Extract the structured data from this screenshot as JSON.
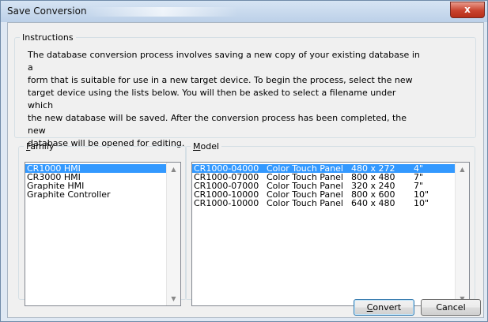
{
  "window": {
    "title": "Save Conversion",
    "close_glyph": "x"
  },
  "instructions": {
    "legend": "Instructions",
    "lines": [
      "The database conversion process involves saving a new copy of your existing database in a",
      "form that is suitable for use in a new target device. To begin the process, select the new",
      "target device using the lists below. You will then be asked to select a filename under which",
      "the new database will be saved. After the conversion process has been completed, the new",
      "database will be opened for editing."
    ]
  },
  "family": {
    "legend_underlined": "F",
    "legend_rest": "amily",
    "items": [
      "CR1000 HMI",
      "CR3000 HMI",
      "Graphite HMI",
      "Graphite Controller"
    ]
  },
  "model": {
    "legend_underlined": "M",
    "legend_rest": "odel",
    "rows": [
      [
        "CR1000-04000",
        "Color Touch Panel",
        "480 x 272",
        "4\""
      ],
      [
        "CR1000-07000",
        "Color Touch Panel",
        "800 x 480",
        "7\""
      ],
      [
        "CR1000-07000",
        "Color Touch Panel",
        "320 x 240",
        "7\""
      ],
      [
        "CR1000-10000",
        "Color Touch Panel",
        "800 x 600",
        "10\""
      ],
      [
        "CR1000-10000",
        "Color Touch Panel",
        "640 x 480",
        "10\""
      ]
    ]
  },
  "buttons": {
    "convert_underlined": "C",
    "convert_rest": "onvert",
    "cancel": "Cancel"
  },
  "colors": {
    "selection": "#3399ff",
    "close_button": "#c9432e"
  }
}
